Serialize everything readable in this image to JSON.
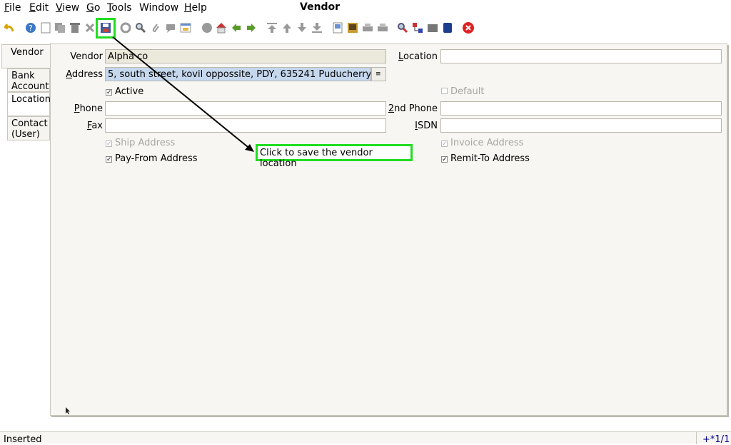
{
  "menu": {
    "file": "File",
    "edit": "Edit",
    "view": "View",
    "go": "Go",
    "tools": "Tools",
    "window": "Window",
    "help": "Help"
  },
  "window_title": "Vendor",
  "toolbar_icons": [
    "undo-icon",
    "help-icon",
    "new-icon",
    "copy-icon",
    "delete-icon",
    "delete-selection-icon",
    "save-icon",
    "refresh-icon",
    "find-icon",
    "attachment-icon",
    "chat-icon",
    "history-icon",
    "archive-icon",
    "home-icon",
    "back-icon",
    "forward-icon",
    "first-record-icon",
    "previous-record-icon",
    "next-record-icon",
    "last-record-icon",
    "report-icon",
    "print-preview-icon",
    "print-icon",
    "zoom-icon",
    "workflow-icon",
    "request-icon",
    "product-info-icon",
    "close-icon"
  ],
  "tabs": {
    "vendor": "Vendor",
    "bank_account_1": "Bank",
    "bank_account_2": "Account",
    "location": "Location",
    "contact_1": "Contact",
    "contact_2": "(User)"
  },
  "form": {
    "vendor_label": "Vendor",
    "vendor_value": "Alpha co",
    "address_label": "Address",
    "address_value": "5, south street, kovil oppossite, PDY,  635241 Puducherry",
    "active_label": "Active",
    "active_checked": true,
    "default_label": "Default",
    "default_checked": false,
    "location_label": "Location",
    "location_value": "",
    "phone_label": "Phone",
    "phone_value": "",
    "phone2_label": "2nd Phone",
    "phone2_value": "",
    "fax_label": "Fax",
    "fax_value": "",
    "isdn_label": "ISDN",
    "isdn_value": "",
    "ship_label": "Ship Address",
    "ship_checked": true,
    "invoice_label": "Invoice Address",
    "invoice_checked": true,
    "payfrom_label": "Pay-From Address",
    "payfrom_checked": true,
    "remitto_label": "Remit-To Address",
    "remitto_checked": true
  },
  "annotation": {
    "text": "Click to save the vendor location",
    "color": "#22dd22"
  },
  "status": {
    "text": "Inserted",
    "record": "+*1/1"
  }
}
